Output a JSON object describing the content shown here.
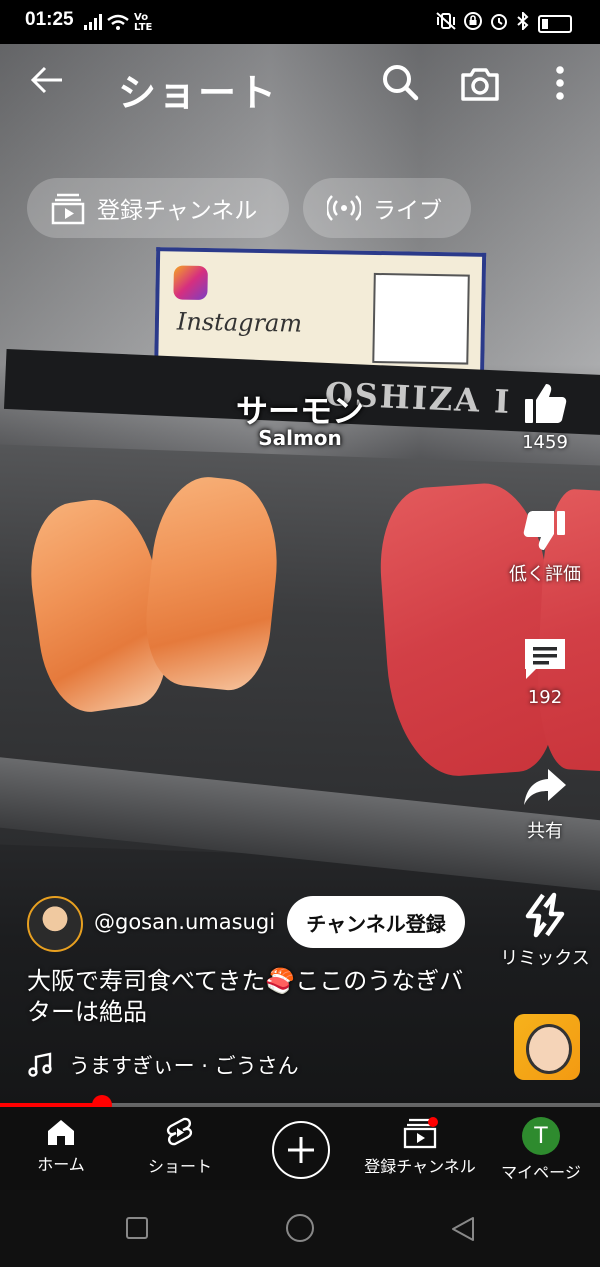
{
  "status_bar": {
    "time": "01:25",
    "signal_text": "Vo LTE"
  },
  "header": {
    "title": "ショート"
  },
  "chips": {
    "subscriptions": "登録チャンネル",
    "live": "ライブ"
  },
  "video": {
    "caption_jp": "サーモン",
    "caption_en": "Salmon",
    "sign_brand": "Instagram",
    "bar_text": "OSHIZA I"
  },
  "actions": {
    "like_count": "1459",
    "dislike_label": "低く評価",
    "comment_count": "192",
    "share_label": "共有",
    "remix_label": "リミックス"
  },
  "channel": {
    "handle": "@gosan.umasugi",
    "subscribe_label": "チャンネル登録"
  },
  "description": "大阪で寿司食べてきた🍣ここのうなぎバターは絶品",
  "music": {
    "title": "うますぎぃー · ごうさん"
  },
  "progress": {
    "fraction": 0.17
  },
  "bottom_nav": {
    "home": "ホーム",
    "shorts": "ショート",
    "subscriptions": "登録チャンネル",
    "mypage": "マイページ",
    "avatar_letter": "T"
  },
  "colors": {
    "accent_red": "#ff0000",
    "nav_bg": "#0f0f0f",
    "avatar_green": "#2e8b2e"
  }
}
